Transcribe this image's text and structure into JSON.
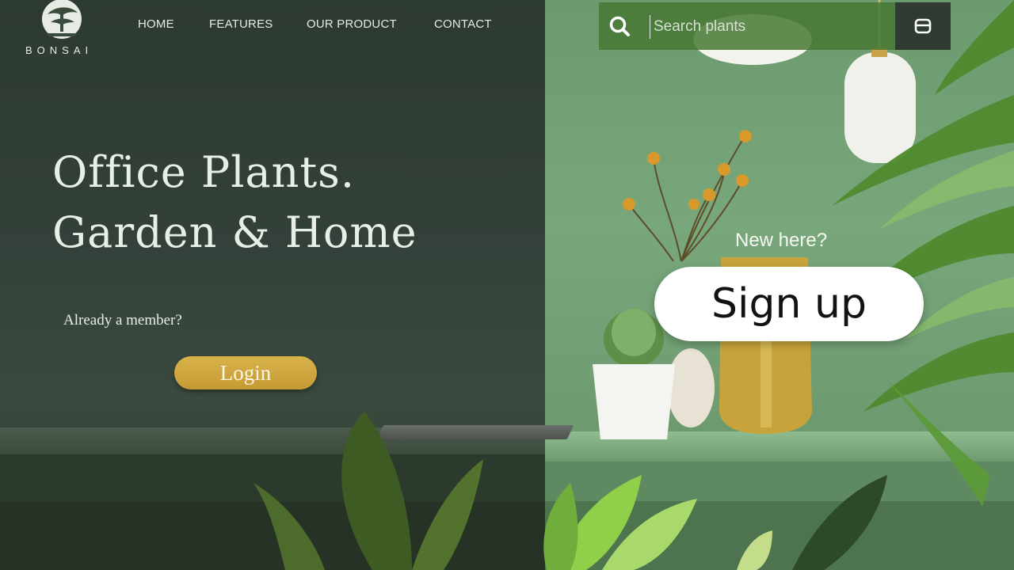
{
  "brand": {
    "name": "BONSAI",
    "logo_icon": "bonsai-tree-icon"
  },
  "nav": {
    "items": [
      {
        "label": "HOME"
      },
      {
        "label": "FEATURES"
      },
      {
        "label": "OUR PRODUCT"
      },
      {
        "label": "CONTACT"
      }
    ]
  },
  "search": {
    "placeholder": "Search plants",
    "value": "",
    "icon": "search-icon"
  },
  "cart": {
    "icon": "cart-icon"
  },
  "hero": {
    "line1": "Office Plants.",
    "line2": "Garden & Home"
  },
  "member": {
    "prompt": "Already a member?",
    "login_label": "Login"
  },
  "newcomer": {
    "prompt": "New here?",
    "signup_label": "Sign up"
  },
  "colors": {
    "left_panel": "#2f3a30",
    "right_panel": "#78a77b",
    "search_bar": "#487834",
    "login_button": "#c9a23c",
    "signup_button": "#ffffff",
    "hero_text": "#e8efe6"
  }
}
